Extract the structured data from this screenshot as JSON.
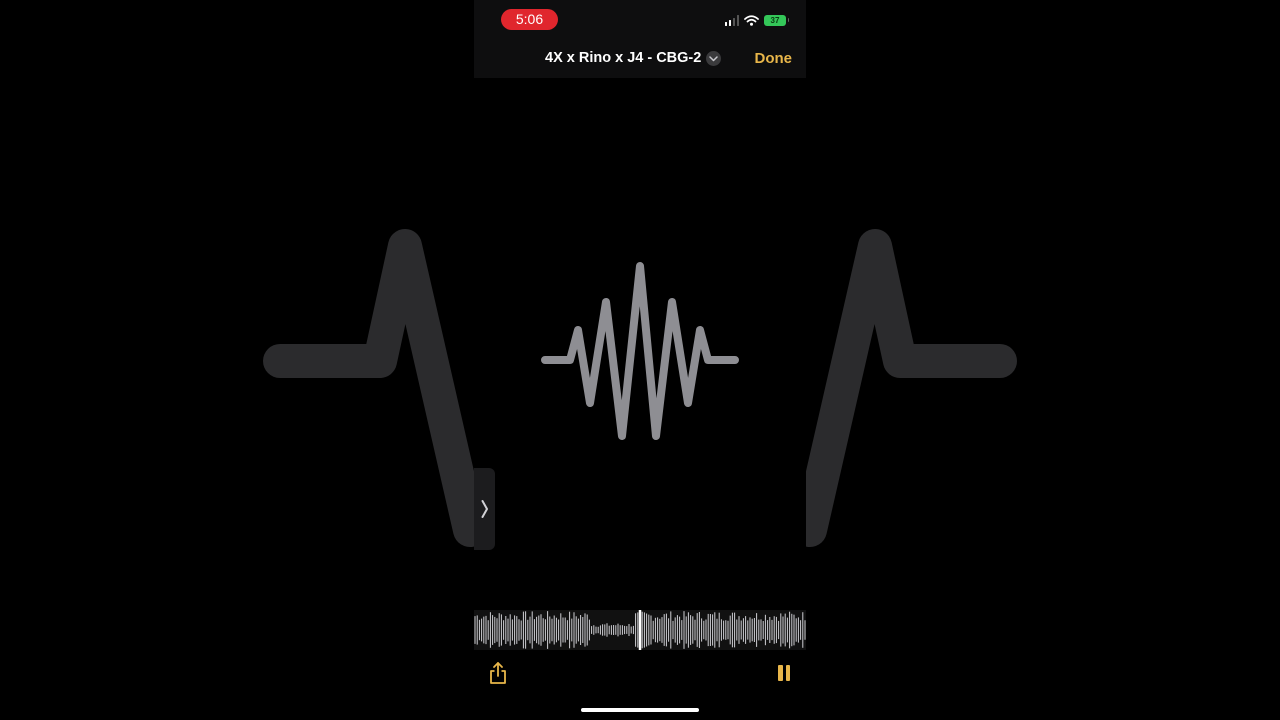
{
  "status_bar": {
    "time": "5:06",
    "battery_level": "37",
    "icons": [
      "signal-icon",
      "wifi-icon",
      "battery-icon"
    ]
  },
  "header": {
    "title": "4X x Rino x J4 - CBG-2",
    "title_menu_icon": "chevron-down-icon",
    "done_label": "Done"
  },
  "player": {
    "state": "playing",
    "center_icon": "waveform-icon",
    "side_tab_icon": "chevron-right-icon",
    "share_icon": "share-icon",
    "pause_icon": "pause-icon",
    "playhead_position": 0.5
  },
  "colors": {
    "accent": "#e8b64a",
    "recording_pill": "#e0262d",
    "battery": "#34c759",
    "waveform": "#8e8e93",
    "background": "#000000"
  }
}
